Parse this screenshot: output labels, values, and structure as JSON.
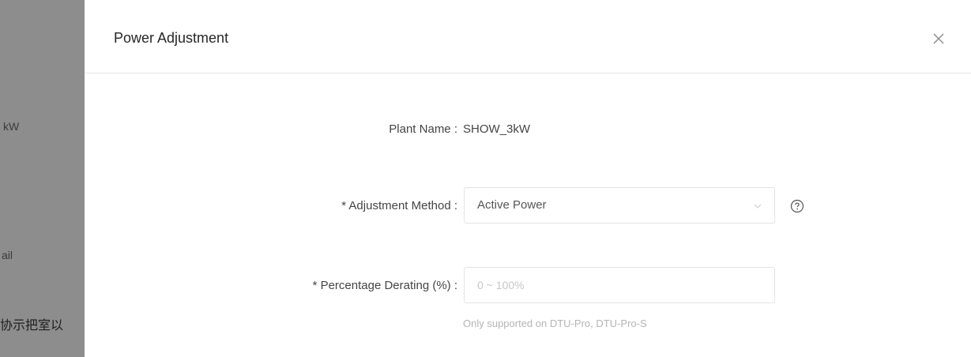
{
  "background": {
    "fragments": [
      "kW",
      "ail",
      "协示把室以"
    ]
  },
  "modal": {
    "title": "Power Adjustment",
    "close_icon": "close-icon",
    "fields": {
      "plant_name": {
        "label": "Plant Name :",
        "value": "SHOW_3kW"
      },
      "adjustment_method": {
        "label": "* Adjustment Method :",
        "value": "Active Power",
        "help_icon": "question-circle-icon"
      },
      "percentage_derating": {
        "label": "* Percentage Derating (%) :",
        "placeholder": "0 ~ 100%",
        "value": "",
        "hint": "Only supported on DTU-Pro, DTU-Pro-S"
      }
    }
  },
  "colors": {
    "overlay": "#8d8d8d",
    "border": "#e3e3e3",
    "placeholder": "#c7c7c7",
    "hint": "#b5b5b5"
  }
}
